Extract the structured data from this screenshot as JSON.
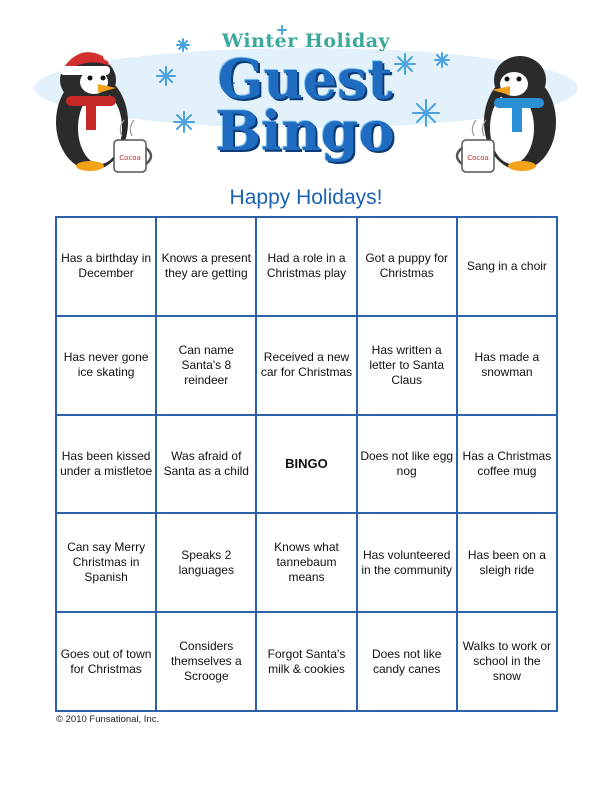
{
  "header": {
    "title_small": "Winter Holiday",
    "title_line1": "Guest",
    "title_line2": "Bingo",
    "mug_label": "Cocoa",
    "colors": {
      "title_small": "#3aa89a",
      "title_big": "#1f6cc0",
      "snow_band": "#e3f1fb"
    }
  },
  "subtitle": "Happy Holidays!",
  "bingo": {
    "cells": [
      "Has a birthday in December",
      "Knows a present they are getting",
      "Had a role in a Christmas play",
      "Got a puppy for Christmas",
      "Sang in a choir",
      "Has never gone ice skating",
      "Can name Santa's 8 reindeer",
      "Received a new car for Christmas",
      "Has written a letter to Santa Claus",
      "Has made a snowman",
      "Has been kissed under a mistletoe",
      "Was afraid of Santa as a child",
      "BINGO",
      "Does not like egg nog",
      "Has a Christmas coffee mug",
      "Can say Merry Christmas in Spanish",
      "Speaks 2 languages",
      "Knows what tannebaum means",
      "Has volunteered in the community",
      "Has been on a sleigh ride",
      "Goes out of town for Christmas",
      "Considers themselves a Scrooge",
      "Forgot Santa's milk & cookies",
      "Does not like candy canes",
      "Walks to work or school in the snow"
    ]
  },
  "footer": {
    "copyright": "© 2010 Funsational, Inc."
  }
}
